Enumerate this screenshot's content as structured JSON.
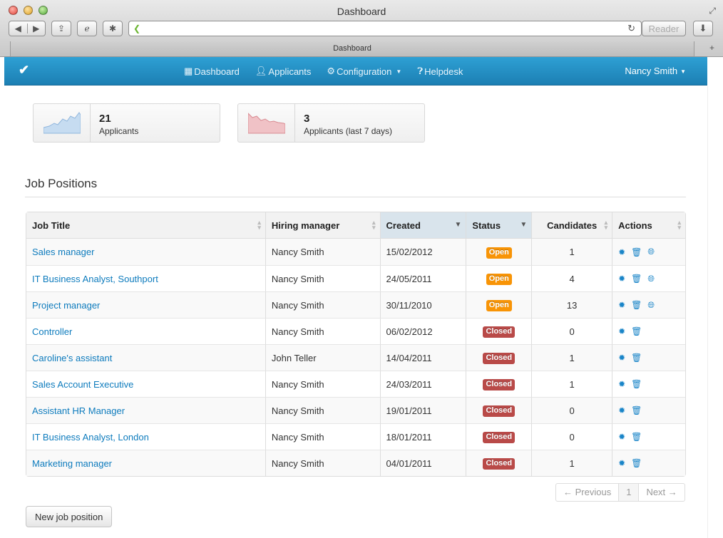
{
  "browser": {
    "window_title": "Dashboard",
    "tab_title": "Dashboard",
    "url": "",
    "reader_label": "Reader"
  },
  "nav": {
    "brand_icon": "checkmark-icon",
    "links": [
      {
        "label": "Dashboard",
        "icon": "grid-icon"
      },
      {
        "label": "Applicants",
        "icon": "user-icon"
      },
      {
        "label": "Configuration",
        "icon": "gear-icon"
      },
      {
        "label": "Helpdesk",
        "icon": "question-icon"
      }
    ],
    "user": "Nancy Smith"
  },
  "stats": [
    {
      "number": "21",
      "label": "Applicants",
      "trend": "up",
      "color": "#a9c8e8"
    },
    {
      "number": "3",
      "label": "Applicants (last 7 days)",
      "trend": "down",
      "color": "#e8a9ad"
    }
  ],
  "section": {
    "title": "Job Positions"
  },
  "table": {
    "headers": [
      "Job Title",
      "Hiring manager",
      "Created",
      "Status",
      "Candidates",
      "Actions"
    ],
    "rows": [
      {
        "title": "Sales manager",
        "manager": "Nancy Smith",
        "created": "15/02/2012",
        "status": "Open",
        "candidates": "1",
        "published": true
      },
      {
        "title": "IT Business Analyst, Southport",
        "manager": "Nancy Smith",
        "created": "24/05/2011",
        "status": "Open",
        "candidates": "4",
        "published": true
      },
      {
        "title": "Project manager",
        "manager": "Nancy Smith",
        "created": "30/11/2010",
        "status": "Open",
        "candidates": "13",
        "published": true
      },
      {
        "title": "Controller",
        "manager": "Nancy Smith",
        "created": "06/02/2012",
        "status": "Closed",
        "candidates": "0",
        "published": false
      },
      {
        "title": "Caroline's assistant",
        "manager": "John Teller",
        "created": "14/04/2011",
        "status": "Closed",
        "candidates": "1",
        "published": false
      },
      {
        "title": "Sales Account Executive",
        "manager": "Nancy Smith",
        "created": "24/03/2011",
        "status": "Closed",
        "candidates": "1",
        "published": false
      },
      {
        "title": "Assistant HR Manager",
        "manager": "Nancy Smith",
        "created": "19/01/2011",
        "status": "Closed",
        "candidates": "0",
        "published": false
      },
      {
        "title": "IT Business Analyst, London",
        "manager": "Nancy Smith",
        "created": "18/01/2011",
        "status": "Closed",
        "candidates": "0",
        "published": false
      },
      {
        "title": "Marketing manager",
        "manager": "Nancy Smith",
        "created": "04/01/2011",
        "status": "Closed",
        "candidates": "1",
        "published": false
      }
    ]
  },
  "pagination": {
    "previous": "← Previous",
    "current": "1",
    "next": "Next →"
  },
  "buttons": {
    "new_job": "New job position"
  },
  "colors": {
    "accent": "#1c7fb3",
    "link": "#0d7bbd",
    "open": "#f89406",
    "closed": "#b94a48"
  }
}
